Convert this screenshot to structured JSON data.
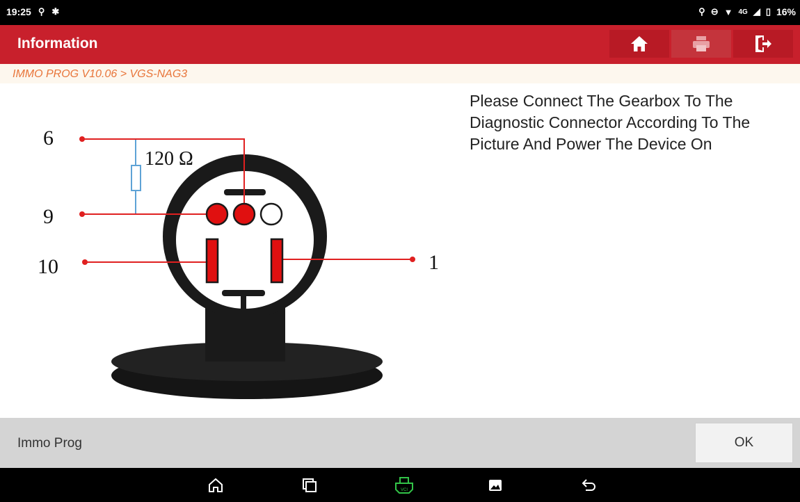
{
  "status_bar": {
    "time": "19:25",
    "network": "4G",
    "battery": "16%"
  },
  "header": {
    "title": "Information",
    "buttons": [
      {
        "icon": "home-icon"
      },
      {
        "icon": "print-icon"
      },
      {
        "icon": "exit-icon"
      }
    ]
  },
  "breadcrumb": "IMMO PROG V10.06 > VGS-NAG3",
  "figure": {
    "pins": {
      "p6": "6",
      "p9": "9",
      "p10": "10",
      "p1": "1"
    },
    "resistor_label": "120 Ω"
  },
  "instruction": "Please Connect The Gearbox To The Diagnostic Connector According To The Picture And Power The Device On",
  "footer": {
    "label": "Immo Prog",
    "ok_label": "OK"
  },
  "nav": {
    "buttons": [
      "home-outline-icon",
      "recent-apps-icon",
      "vci-icon",
      "gallery-icon",
      "back-icon"
    ]
  },
  "colors": {
    "header": "#c8202c",
    "breadcrumb_text": "#e8753a",
    "wire": "#e02020",
    "resistor": "#5ea3d6"
  }
}
